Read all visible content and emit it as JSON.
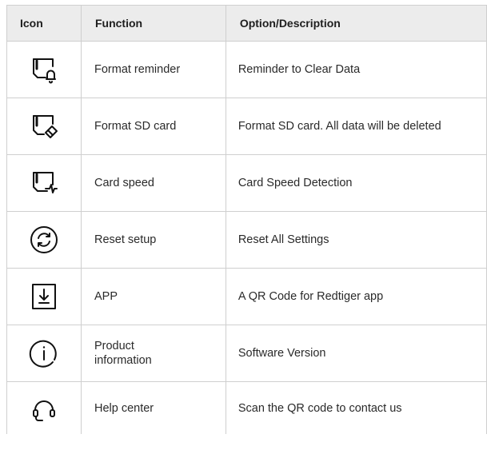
{
  "headers": {
    "icon": "Icon",
    "function": "Function",
    "description": "Option/Description"
  },
  "rows": [
    {
      "icon": "sd-card-bell-icon",
      "function": "Format reminder",
      "description": "Reminder to Clear Data"
    },
    {
      "icon": "sd-card-eraser-icon",
      "function": "Format SD card",
      "description": "Format SD card. All data will be deleted"
    },
    {
      "icon": "sd-card-pulse-icon",
      "function": "Card speed",
      "description": "Card Speed Detection"
    },
    {
      "icon": "reset-circle-arrows-icon",
      "function": "Reset setup",
      "description": "Reset All Settings"
    },
    {
      "icon": "download-box-icon",
      "function": "APP",
      "description": "A QR Code for Redtiger app"
    },
    {
      "icon": "info-circle-icon",
      "function": "Product information",
      "description": "Software Version"
    },
    {
      "icon": "headset-icon",
      "function": "Help center",
      "description": "Scan the QR code to contact us"
    }
  ]
}
